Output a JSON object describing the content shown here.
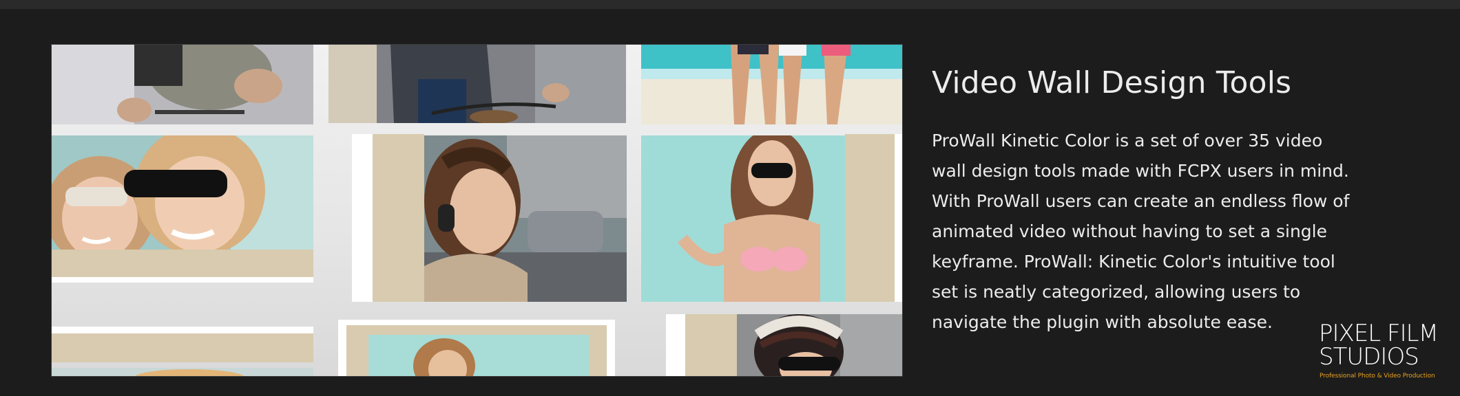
{
  "section": {
    "title": "Video Wall Design Tools",
    "paragraph": "ProWall Kinetic Color is a set of over 35 video wall design tools made with FCPX users in mind. With ProWall users can create an endless flow of animated video without having to set a single keyframe. ProWall: Kinetic Color's intuitive tool set is neatly categorized, allowing users to navigate the plugin with absolute ease."
  },
  "logo": {
    "line1": "PIXEL FILM",
    "line2": "STUDIOS",
    "tagline": "Professional Photo & Video Production",
    "accent_color": "#e8a21f"
  },
  "collage": {
    "description_icons": [
      "photo-cyclist",
      "photo-woman-bicycle",
      "photo-beach-legs",
      "photo-two-women-sunglasses",
      "photo-woman-headphones",
      "photo-woman-bikini",
      "photo-woman-field",
      "photo-woman-beanie"
    ],
    "accent_color": "#d8cbaf"
  }
}
